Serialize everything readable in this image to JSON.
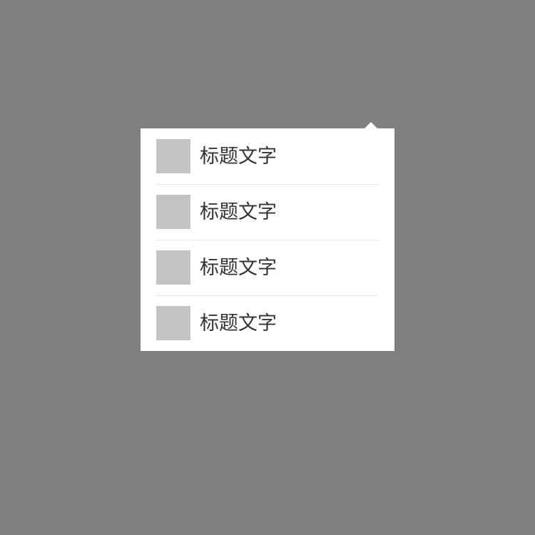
{
  "colors": {
    "overlay": "#808080",
    "popover_background": "#ffffff",
    "icon_placeholder": "#c4c4c4",
    "divider": "#e8e8e8",
    "label_text": "#333333"
  },
  "menu": {
    "items": [
      {
        "label": "标题文字",
        "icon": "image-placeholder-icon"
      },
      {
        "label": "标题文字",
        "icon": "image-placeholder-icon"
      },
      {
        "label": "标题文字",
        "icon": "image-placeholder-icon"
      },
      {
        "label": "标题文字",
        "icon": "image-placeholder-icon"
      }
    ]
  }
}
